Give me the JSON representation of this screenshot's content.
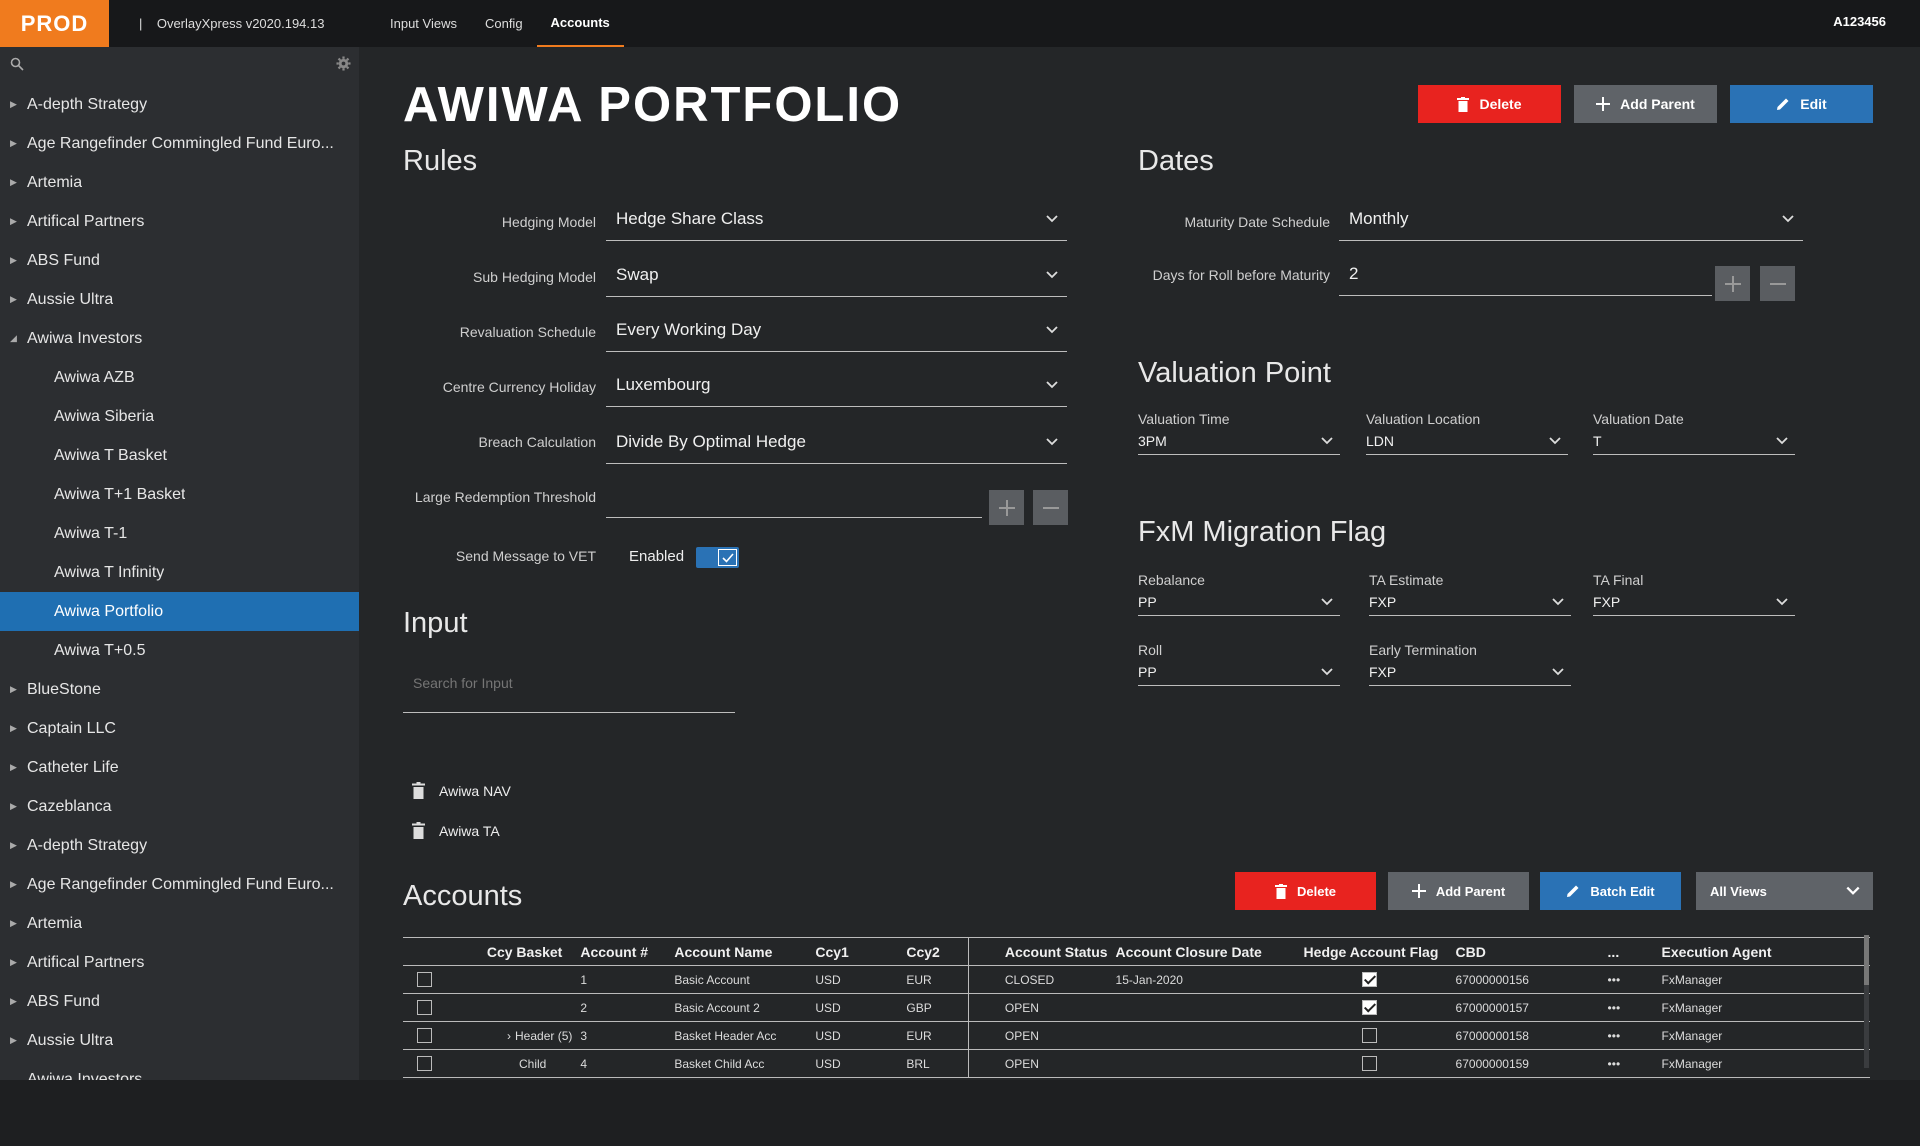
{
  "header": {
    "env": "PROD",
    "app_title": "OverlayXpress v2020.194.13",
    "tabs": [
      {
        "label": "Input Views"
      },
      {
        "label": "Config"
      },
      {
        "label": "Accounts"
      }
    ],
    "user_id": "A123456"
  },
  "sidebar": {
    "items": [
      {
        "label": "A-depth Strategy"
      },
      {
        "label": "Age Rangefinder Commingled Fund Euro..."
      },
      {
        "label": "Artemia"
      },
      {
        "label": "Artifical Partners"
      },
      {
        "label": "ABS Fund"
      },
      {
        "label": "Aussie Ultra"
      },
      {
        "label": "Awiwa Investors"
      },
      {
        "label": "Awiwa AZB"
      },
      {
        "label": "Awiwa Siberia"
      },
      {
        "label": "Awiwa T Basket"
      },
      {
        "label": "Awiwa T+1 Basket"
      },
      {
        "label": "Awiwa T-1"
      },
      {
        "label": "Awiwa T Infinity"
      },
      {
        "label": "Awiwa Portfolio"
      },
      {
        "label": "Awiwa T+0.5"
      },
      {
        "label": "BlueStone"
      },
      {
        "label": "Captain LLC"
      },
      {
        "label": "Catheter Life"
      },
      {
        "label": "Cazeblanca"
      },
      {
        "label": "A-depth Strategy"
      },
      {
        "label": "Age Rangefinder Commingled Fund Euro..."
      },
      {
        "label": "Artemia"
      },
      {
        "label": "Artifical Partners"
      },
      {
        "label": "ABS Fund"
      },
      {
        "label": "Aussie Ultra"
      },
      {
        "label": "Awiwa Investors"
      }
    ]
  },
  "page": {
    "title": "AWIWA PORTFOLIO",
    "delete": "Delete",
    "add_parent": "Add Parent",
    "edit": "Edit"
  },
  "rules": {
    "heading": "Rules",
    "hedging_model": {
      "label": "Hedging Model",
      "value": "Hedge Share Class"
    },
    "sub_hedging_model": {
      "label": "Sub Hedging Model",
      "value": "Swap"
    },
    "revaluation_schedule": {
      "label": "Revaluation Schedule",
      "value": "Every Working Day"
    },
    "centre_currency_holiday": {
      "label": "Centre Currency Holiday",
      "value": "Luxembourg"
    },
    "breach_calculation": {
      "label": "Breach Calculation",
      "value": "Divide By Optimal Hedge"
    },
    "large_redemption_threshold": {
      "label": "Large Redemption Threshold",
      "value": ""
    },
    "send_message": {
      "label": "Send Message to VET",
      "state": "Enabled"
    }
  },
  "input": {
    "heading": "Input",
    "search_placeholder": "Search for Input",
    "items": [
      {
        "label": "Awiwa NAV"
      },
      {
        "label": "Awiwa TA"
      }
    ]
  },
  "dates": {
    "heading": "Dates",
    "maturity_schedule": {
      "label": "Maturity Date Schedule",
      "value": "Monthly"
    },
    "days_roll": {
      "label": "Days for Roll before Maturity",
      "value": "2"
    }
  },
  "valuation": {
    "heading": "Valuation Point",
    "time": {
      "label": "Valuation Time",
      "value": "3PM"
    },
    "location": {
      "label": "Valuation Location",
      "value": "LDN"
    },
    "date": {
      "label": "Valuation Date",
      "value": "T"
    }
  },
  "fxm": {
    "heading": "FxM Migration Flag",
    "rebalance": {
      "label": "Rebalance",
      "value": "PP"
    },
    "ta_estimate": {
      "label": "TA Estimate",
      "value": "FXP"
    },
    "ta_final": {
      "label": "TA Final",
      "value": "FXP"
    },
    "roll": {
      "label": "Roll",
      "value": "PP"
    },
    "early_termination": {
      "label": "Early Termination",
      "value": "FXP"
    }
  },
  "accounts": {
    "heading": "Accounts",
    "delete": "Delete",
    "add_parent": "Add Parent",
    "batch_edit": "Batch Edit",
    "views": "All Views",
    "columns": [
      "Ccy Basket",
      "Account #",
      "Account Name",
      "Ccy1",
      "Ccy2",
      "Account Status",
      "Account Closure Date",
      "Hedge Account Flag",
      "CBD",
      "...",
      "Execution Agent"
    ],
    "rows": [
      {
        "basket": "",
        "num": "1",
        "name": "Basic Account",
        "ccy1": "USD",
        "ccy2": "EUR",
        "status": "CLOSED",
        "closure": "15-Jan-2020",
        "cbd": "67000000156",
        "more": "•••",
        "agent": "FxManager"
      },
      {
        "basket": "",
        "num": "2",
        "name": "Basic Account 2",
        "ccy1": "USD",
        "ccy2": "GBP",
        "status": "OPEN",
        "closure": "",
        "cbd": "67000000157",
        "more": "•••",
        "agent": "FxManager"
      },
      {
        "basket": "Header (5)",
        "num": "3",
        "name": "Basket Header Acc",
        "ccy1": "USD",
        "ccy2": "EUR",
        "status": "OPEN",
        "closure": "",
        "cbd": "67000000158",
        "more": "•••",
        "agent": "FxManager"
      },
      {
        "basket": "Child",
        "num": "4",
        "name": "Basket Child Acc",
        "ccy1": "USD",
        "ccy2": "BRL",
        "status": "OPEN",
        "closure": "",
        "cbd": "67000000159",
        "more": "•••",
        "agent": "FxManager"
      }
    ]
  },
  "colors": {
    "env": "#f07b1e",
    "danger": "#e8231f",
    "primary": "#2a72b5",
    "selected": "#1f6fb2"
  }
}
